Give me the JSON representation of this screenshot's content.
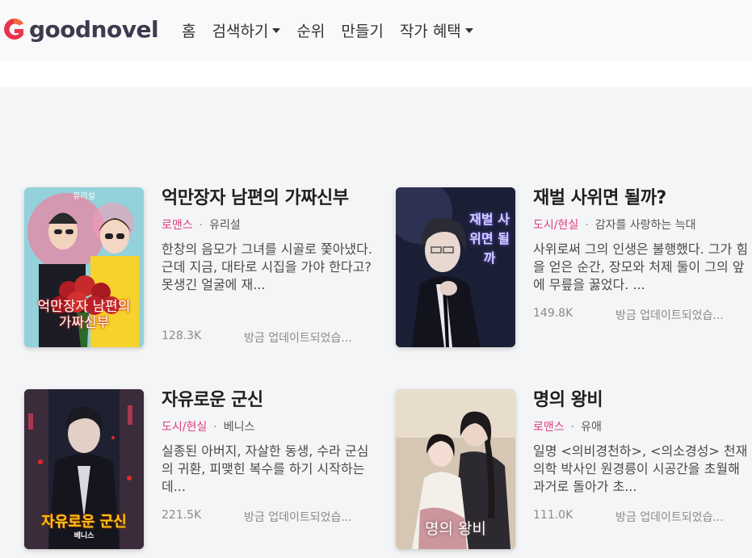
{
  "brand": {
    "name": "goodnovel"
  },
  "nav": [
    {
      "label": "홈",
      "dropdown": false
    },
    {
      "label": "검색하기",
      "dropdown": true
    },
    {
      "label": "순위",
      "dropdown": false
    },
    {
      "label": "만들기",
      "dropdown": false
    },
    {
      "label": "작가 혜택",
      "dropdown": true
    }
  ],
  "books": [
    {
      "title": "억만장자 남편의 가짜신부",
      "category": "로맨스",
      "author": "유리설",
      "description": "한창의 음모가 그녀를 시골로 쫓아냈다. 근데 지금, 대타로 시집을 가야 한다고?못생긴 얼굴에 재...",
      "views": "128.3K",
      "updated": "방금 업데이트되었습...",
      "cover_title": "억만장자 남편의 가짜신부",
      "cover_author": "유리설",
      "colors": {
        "bg": "#8fcfd8",
        "accent": "#c42a2a"
      }
    },
    {
      "title": "재벌 사위면 될까?",
      "category": "도시/현실",
      "author": "감자를 사랑하는 늑대",
      "description": "사위로써 그의 인생은 불행했다. 그가 힘을 얻은 순간, 장모와 처제 둘이 그의 앞에 무릎을 꿇었다. ...",
      "views": "149.8K",
      "updated": "방금 업데이트되었습...",
      "cover_title": "재벌 사위면 될까",
      "colors": {
        "bg": "#1e2340",
        "accent": "#c9c6f0"
      }
    },
    {
      "title": "자유로운 군신",
      "category": "도시/현실",
      "author": "베니스",
      "description": "실종된 아버지, 자살한 동생, 수라 군심의 귀환, 피맺힌 복수를 하기 시작하는데...",
      "views": "221.5K",
      "updated": "방금 업데이트되었습...",
      "cover_title": "자유로운 군신",
      "cover_author": "베니스",
      "colors": {
        "bg": "#23232e",
        "accent": "#f0c020"
      }
    },
    {
      "title": "명의 왕비",
      "category": "로맨스",
      "author": "유애",
      "description": "일명 <의비경천하>, <의소경성> 천재 의학 박사인 원경릉이 시공간을 초월해 과거로 돌아가 초...",
      "views": "111.0K",
      "updated": "방금 업데이트되었습...",
      "cover_title": "명의 왕비",
      "colors": {
        "bg": "#d9cbbb",
        "accent": "#ffffff"
      }
    }
  ],
  "colors": {
    "category": "#e0407a",
    "logo_red": "#e8344e",
    "text": "#333333"
  }
}
